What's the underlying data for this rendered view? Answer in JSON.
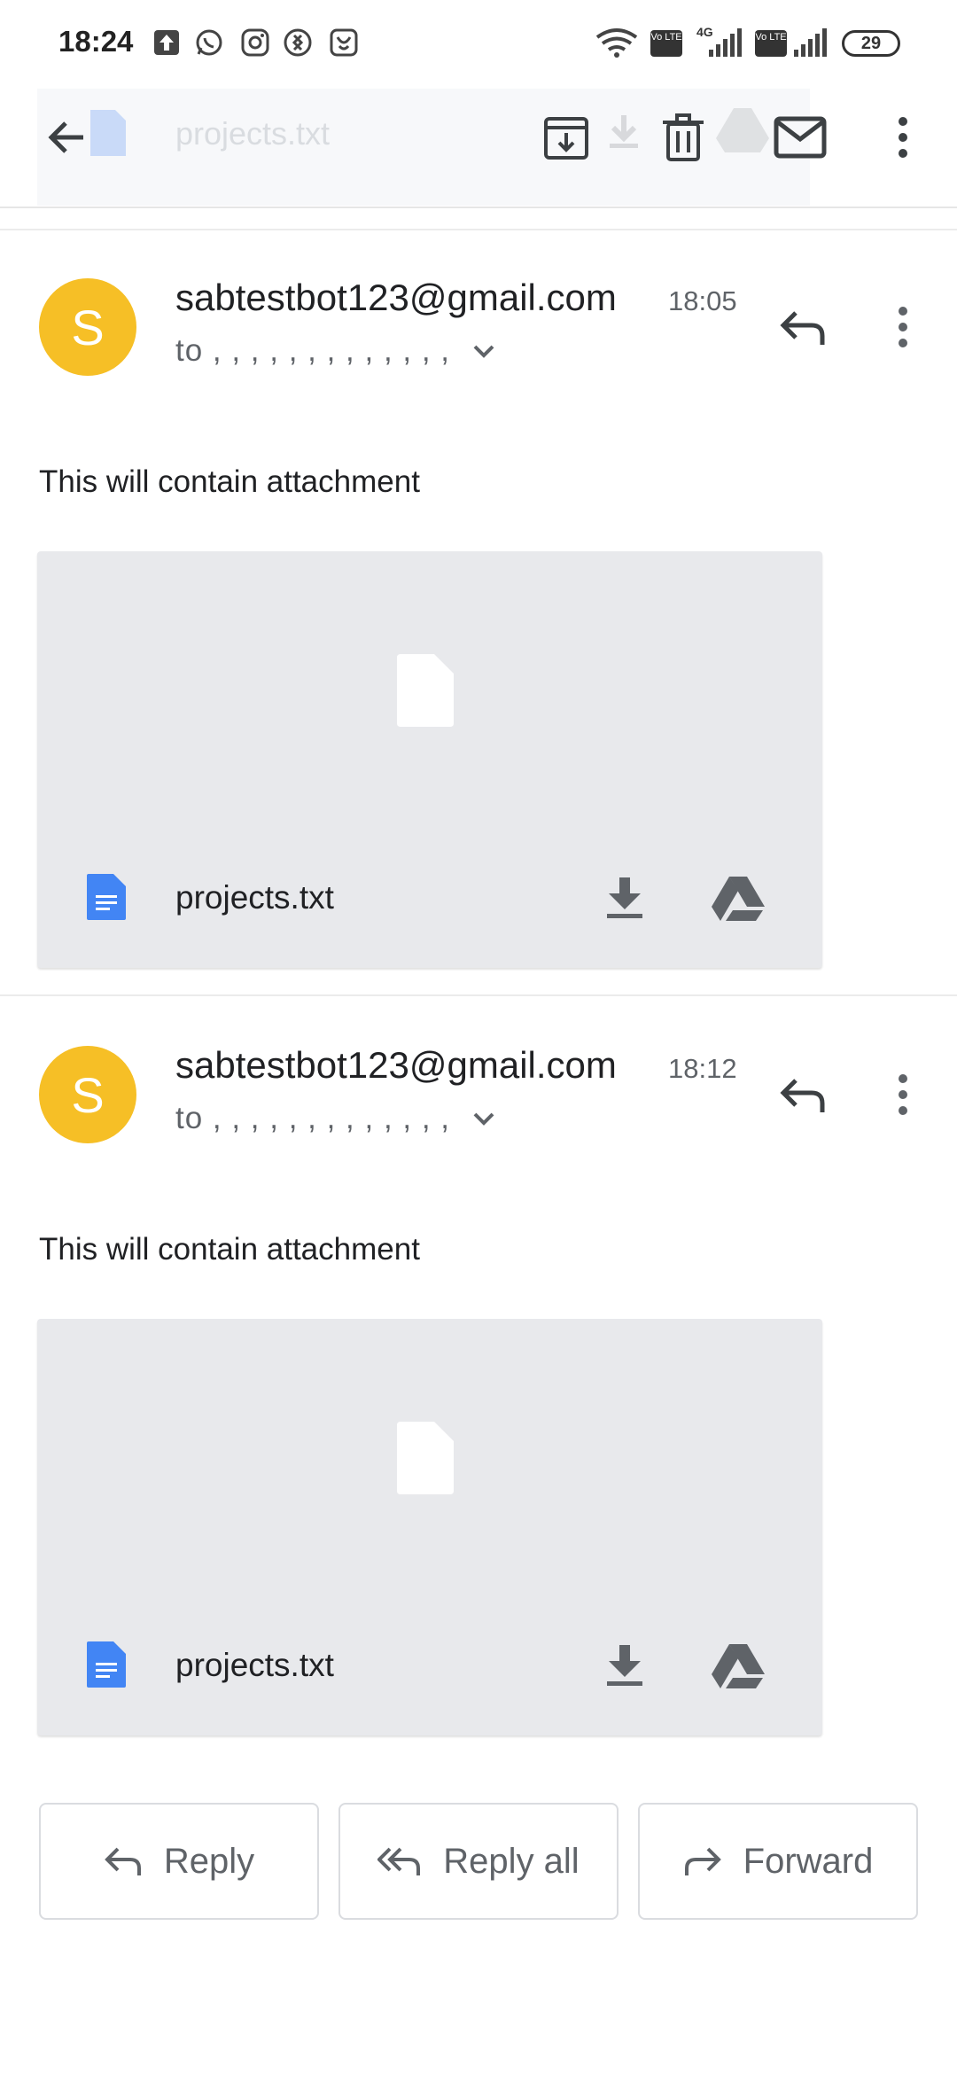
{
  "status_bar": {
    "time": "18:24",
    "battery": "29",
    "net_label_1": "Vo LTE",
    "net_label_2": "4G",
    "net_label_3": "Vo LTE",
    "notification_icons": [
      "upload-icon",
      "whatsapp-icon",
      "instagram-icon",
      "shazam-icon",
      "saavn-icon"
    ]
  },
  "toolbar": {
    "ghost_title": "projects.txt",
    "actions": [
      "back-icon",
      "archive-icon",
      "delete-icon",
      "mark-unread-icon",
      "more-options-icon"
    ]
  },
  "messages": [
    {
      "avatar_letter": "S",
      "sender": "sabtestbot123@gmail.com",
      "time": "18:05",
      "recipients": "to , , , , , , , , , , , , ,",
      "body": "This will contain attachment",
      "attachment": {
        "file_name": "projects.txt"
      }
    },
    {
      "avatar_letter": "S",
      "sender": "sabtestbot123@gmail.com",
      "time": "18:12",
      "recipients": "to , , , , , , , , , , , , ,",
      "body": "This will contain attachment",
      "attachment": {
        "file_name": "projects.txt"
      }
    }
  ],
  "actions": {
    "reply_label": "Reply",
    "reply_all_label": "Reply all",
    "forward_label": "Forward"
  },
  "colors": {
    "avatar": "#f6bf26",
    "doc_icon": "#4285f4",
    "attachment_bg": "#e8e9ec",
    "icon_gray": "#5f6368"
  }
}
